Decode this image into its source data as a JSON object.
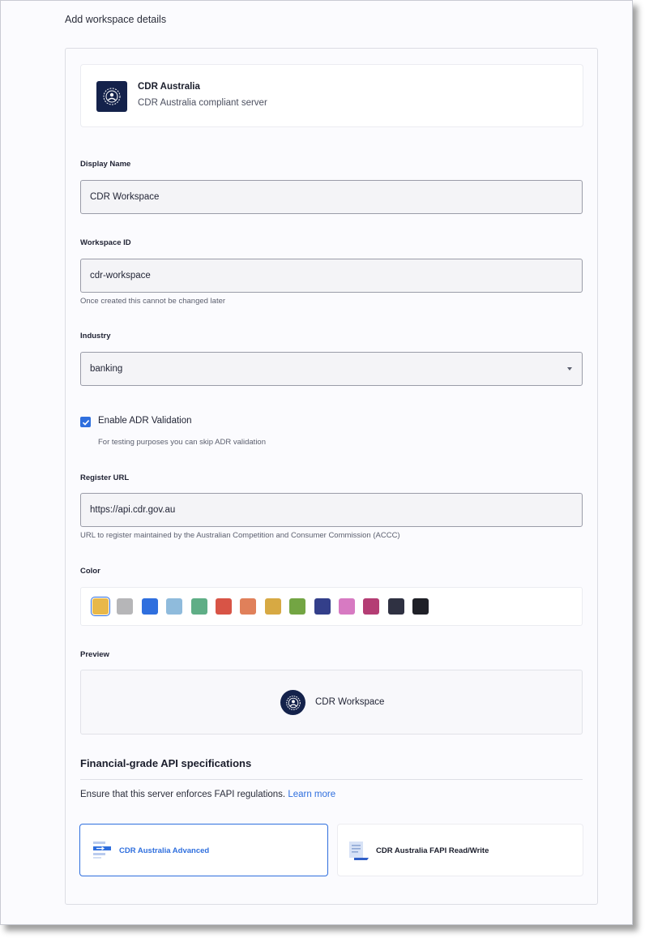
{
  "page": {
    "heading": "Add workspace details"
  },
  "server": {
    "name": "CDR Australia",
    "description": "CDR Australia compliant server",
    "logo_icon": "radar-person-icon",
    "logo_bg": "#14224b"
  },
  "form": {
    "display_name": {
      "label": "Display Name",
      "value": "CDR Workspace"
    },
    "workspace_id": {
      "label": "Workspace ID",
      "value": "cdr-workspace",
      "helper": "Once created this cannot be changed later"
    },
    "industry": {
      "label": "Industry",
      "value": "banking"
    },
    "adr_validation": {
      "label": "Enable ADR Validation",
      "checked": true,
      "helper": "For testing purposes you can skip ADR validation"
    },
    "register_url": {
      "label": "Register URL",
      "value": "https://api.cdr.gov.au",
      "helper": "URL to register maintained by the Australian Competition and Consumer Commission (ACCC)"
    },
    "color": {
      "label": "Color",
      "selected_index": 0,
      "options": [
        "#e8b84a",
        "#b6b6b8",
        "#2f6fde",
        "#8fbbdc",
        "#5fae86",
        "#d85446",
        "#e0805a",
        "#d7a943",
        "#73a543",
        "#333f8a",
        "#d77ac2",
        "#b43d74",
        "#2f3142",
        "#1f2027"
      ]
    },
    "preview": {
      "label": "Preview",
      "name": "CDR Workspace"
    }
  },
  "fapi": {
    "title": "Financial-grade API specifications",
    "description": "Ensure that this server enforces FAPI regulations.",
    "learn_more": "Learn more",
    "options": [
      {
        "label": "CDR Australia Advanced",
        "icon": "arrow-document-icon",
        "selected": true
      },
      {
        "label": "CDR Australia FAPI Read/Write",
        "icon": "document-lines-icon",
        "selected": false
      }
    ]
  },
  "colors": {
    "accent": "#2f6fde",
    "text": "#1f2233",
    "muted": "#5b5f6e"
  }
}
